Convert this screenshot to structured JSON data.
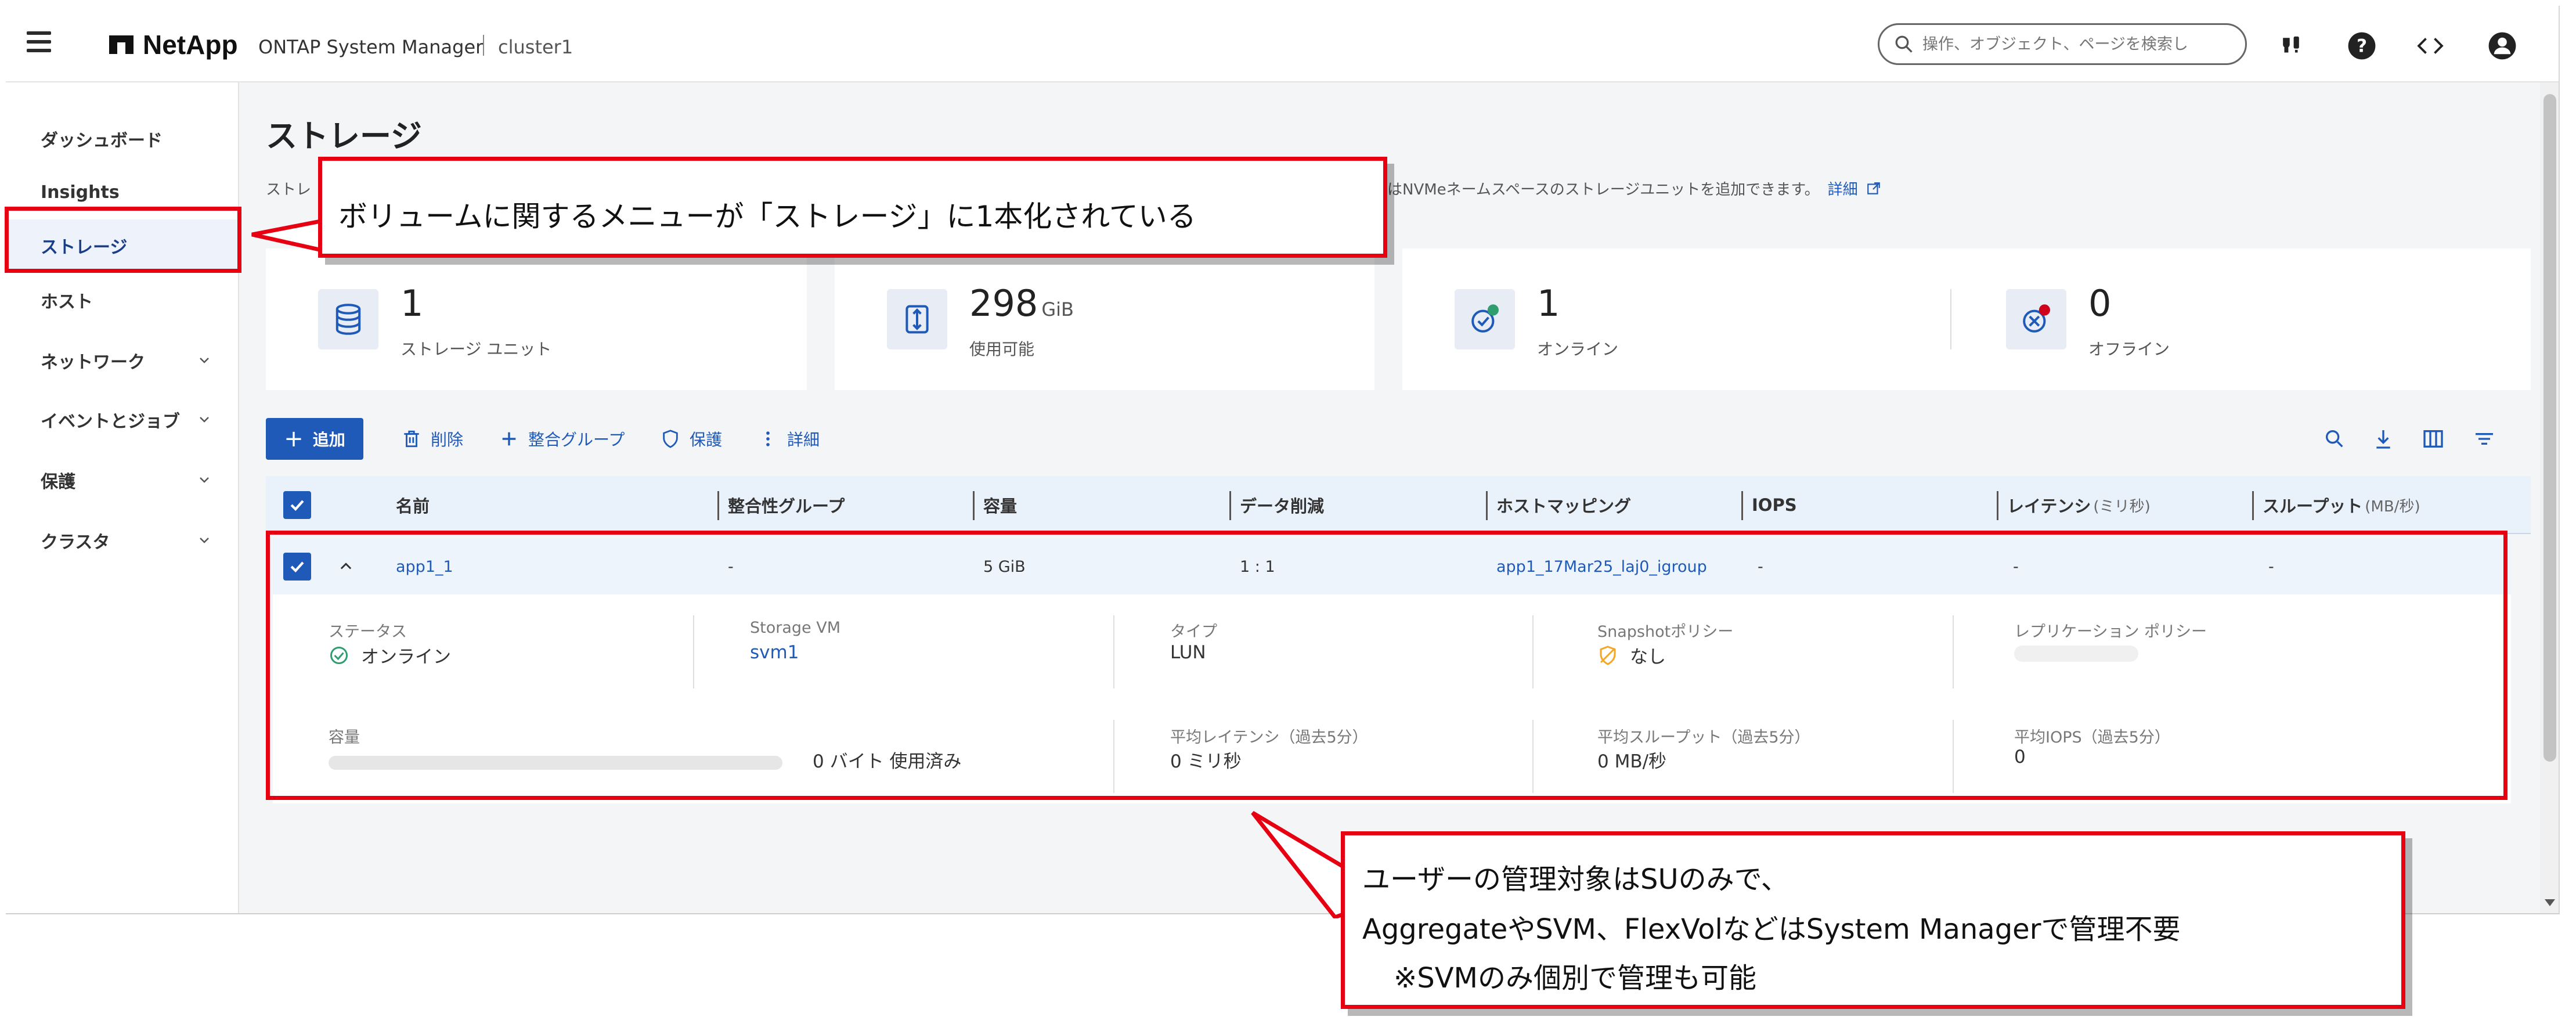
{
  "header": {
    "brand": "NetApp",
    "app_title": "ONTAP System Manager",
    "cluster": "cluster1",
    "search_placeholder": "操作、オブジェクト、ページを検索し"
  },
  "sidebar": {
    "items": [
      {
        "label": "ダッシュボード"
      },
      {
        "label": "Insights"
      },
      {
        "label": "ストレージ"
      },
      {
        "label": "ホスト"
      },
      {
        "label": "ネットワーク"
      },
      {
        "label": "イベントとジョブ"
      },
      {
        "label": "保護"
      },
      {
        "label": "クラスタ"
      }
    ]
  },
  "page": {
    "title": "ストレージ",
    "desc_left": "ストレ",
    "desc_right": "はNVMeネームスペースのストレージユニットを追加できます。",
    "desc_link": "詳細"
  },
  "cards": [
    {
      "value": "1",
      "unit": "",
      "label": "ストレージ ユニット"
    },
    {
      "value": "298",
      "unit": "GiB",
      "label": "使用可能"
    },
    {
      "value": "1",
      "unit": "",
      "label": "オンライン"
    },
    {
      "value": "0",
      "unit": "",
      "label": "オフライン"
    }
  ],
  "toolbar": {
    "add": "追加",
    "delete": "削除",
    "consistency_group": "整合グループ",
    "protect": "保護",
    "more": "詳細"
  },
  "table": {
    "headers": {
      "name": "名前",
      "cg": "整合性グループ",
      "capacity": "容量",
      "reduction": "データ削減",
      "host_mapping": "ホストマッピング",
      "iops": "IOPS",
      "latency": "レイテンシ",
      "latency_unit": "(ミリ秒)",
      "throughput": "スループット",
      "throughput_unit": "(MB/秒)"
    },
    "rows": [
      {
        "name": "app1_1",
        "cg": "-",
        "capacity": "5 GiB",
        "reduction": "1 : 1",
        "host_mapping": "app1_17Mar25_laj0_igroup",
        "iops": "-",
        "latency": "-",
        "throughput": "-"
      }
    ]
  },
  "detail": {
    "status_label": "ステータス",
    "status_value": "オンライン",
    "svm_label": "Storage VM",
    "svm_value": "svm1",
    "type_label": "タイプ",
    "type_value": "LUN",
    "snapshot_label": "Snapshotポリシー",
    "snapshot_value": "なし",
    "replication_label": "レプリケーション ポリシー",
    "capacity_label": "容量",
    "capacity_value": "0 バイト 使用済み",
    "capacity_used_fraction": 0,
    "latency_label": "平均レイテンシ（過去5分）",
    "latency_value": "0 ミリ秒",
    "throughput_label": "平均スループット（過去5分）",
    "throughput_value": "0 MB/秒",
    "iops_label": "平均IOPS（過去5分）",
    "iops_value": "0"
  },
  "annotations": {
    "callout1": "ボリュームに関するメニューが「ストレージ」に1本化されている",
    "callout2_line1": "ユーザーの管理対象はSUのみで、",
    "callout2_line2": "AggregateやSVM、FlexVolなどはSystem Managerで管理不要",
    "callout2_line3": "※SVMのみ個別で管理も可能",
    "highlight_color": "#e60012"
  },
  "colors": {
    "accent": "#1f5ab8",
    "online": "#2f9e6e",
    "offline": "#d0021b",
    "warning": "#f5a623"
  }
}
